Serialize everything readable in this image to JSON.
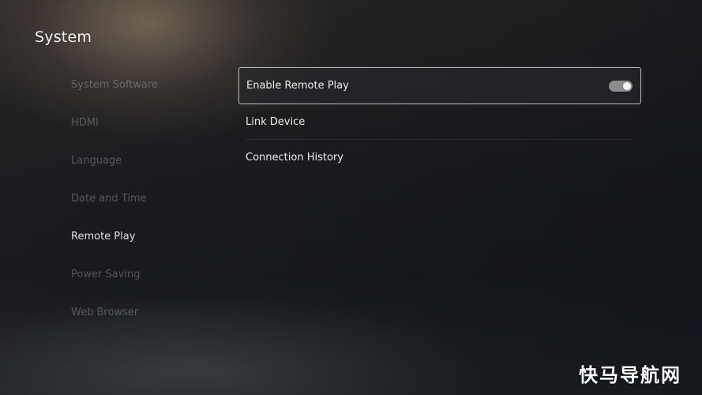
{
  "page": {
    "title": "System"
  },
  "sidebar": {
    "items": [
      {
        "label": "System Software",
        "active": false
      },
      {
        "label": "HDMI",
        "active": false
      },
      {
        "label": "Language",
        "active": false
      },
      {
        "label": "Date and Time",
        "active": false
      },
      {
        "label": "Remote Play",
        "active": true
      },
      {
        "label": "Power Saving",
        "active": false
      },
      {
        "label": "Web Browser",
        "active": false
      }
    ]
  },
  "panel": {
    "rows": [
      {
        "label": "Enable Remote Play",
        "toggle": "on"
      },
      {
        "label": "Link Device"
      },
      {
        "label": "Connection History"
      }
    ]
  },
  "watermark": {
    "text": "快马导航网"
  },
  "colors": {
    "toggle_track": "#8c8c8c",
    "toggle_knob": "#f5f5f5",
    "focus_border": "#e6e6e6"
  }
}
